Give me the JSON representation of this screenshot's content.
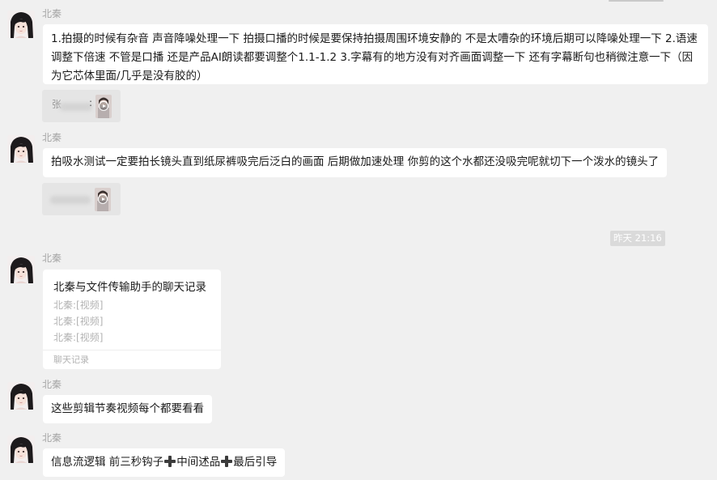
{
  "messages": [
    {
      "sender": "北秦",
      "text": "1.拍摄的时候有杂音 声音降噪处理一下 拍摄口播的时候是要保持拍摄周围环境安静的 不是太嘈杂的环境后期可以降噪处理一下 2.语速调整下倍速 不管是口播 还是产品AI朗读都要调整个1.1-1.2 3.字幕有的地方没有对齐画面调整一下 还有字幕断句也稍微注意一下（因为它芯体里面/几乎是没有胶的）"
    },
    {
      "attachment": {
        "prefix": "张",
        "colon": ":",
        "icon": "video-play-icon"
      }
    },
    {
      "sender": "北秦",
      "text": "拍吸水测试一定要拍长镜头直到纸尿裤吸完后泛白的画面 后期做加速处理 你剪的这个水都还没吸完呢就切下一个泼水的镜头了"
    },
    {
      "attachment": {
        "prefix": "",
        "colon": "",
        "icon": "video-play-icon"
      }
    },
    {
      "timestamp": "昨天 21:16"
    },
    {
      "sender": "北秦",
      "chat_record": {
        "title": "北秦与文件传输助手的聊天记录",
        "lines": [
          "北秦:[视频]",
          "北秦:[视频]",
          "北秦:[视频]"
        ],
        "footer": "聊天记录"
      }
    },
    {
      "sender": "北秦",
      "text": "这些剪辑节奏视频每个都要看看"
    },
    {
      "sender": "北秦",
      "text_parts": [
        "信息流逻辑 前三秒钩子",
        "中间述品",
        "最后引导"
      ],
      "icon": "heavy-plus-icon"
    }
  ]
}
